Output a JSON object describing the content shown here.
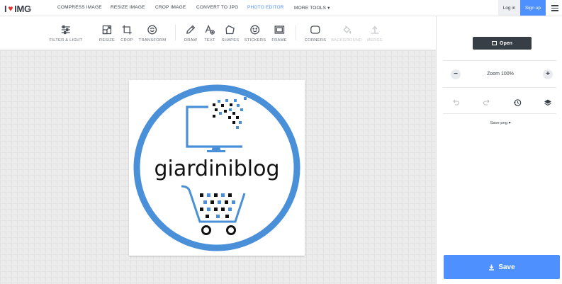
{
  "brand": {
    "logo_left": "I",
    "logo_right": "IMG",
    "heart_color": "#e5322d",
    "accent": "#4d90fe"
  },
  "nav": {
    "items": [
      "COMPRESS IMAGE",
      "RESIZE IMAGE",
      "CROP IMAGE",
      "CONVERT TO JPG",
      "PHOTO EDITOR",
      "MORE TOOLS ▾"
    ],
    "active_index": 4,
    "login": "Log in",
    "signup": "Sign up"
  },
  "toolbar": {
    "tools": [
      {
        "label": "FILTER & LIGHT",
        "icon": "sliders-icon",
        "enabled": true
      },
      {
        "label": "RESIZE",
        "icon": "resize-icon",
        "enabled": true
      },
      {
        "label": "CROP",
        "icon": "crop-icon",
        "enabled": true
      },
      {
        "label": "TRANSFORM",
        "icon": "transform-icon",
        "enabled": true
      },
      {
        "label": "DRAW",
        "icon": "pencil-icon",
        "enabled": true
      },
      {
        "label": "TEXT",
        "icon": "text-icon",
        "enabled": true
      },
      {
        "label": "SHAPES",
        "icon": "shapes-icon",
        "enabled": true
      },
      {
        "label": "STICKERS",
        "icon": "smiley-icon",
        "enabled": true
      },
      {
        "label": "FRAME",
        "icon": "frame-icon",
        "enabled": true
      },
      {
        "label": "CORNERS",
        "icon": "corners-icon",
        "enabled": true
      },
      {
        "label": "BACKGROUND",
        "icon": "paint-bucket-icon",
        "enabled": false
      },
      {
        "label": "MERGE",
        "icon": "merge-icon",
        "enabled": false
      }
    ]
  },
  "canvas_image": {
    "logo_text": "giardiniblog",
    "ring_color": "#4a90d9"
  },
  "panel": {
    "open_label": "Open",
    "zoom_label": "Zoom",
    "zoom_value": "100%",
    "zoom_out": "−",
    "zoom_in": "+",
    "save_format": "Save png ▾",
    "save_label": "Save"
  }
}
